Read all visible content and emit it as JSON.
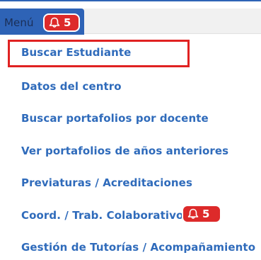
{
  "menu": {
    "label": "Menú",
    "notification_count": "5"
  },
  "items": [
    {
      "label": "Buscar Estudiante"
    },
    {
      "label": "Datos del centro"
    },
    {
      "label": "Buscar portafolios por docente"
    },
    {
      "label": "Ver portafolios de años anteriores"
    },
    {
      "label": "Previaturas / Acreditaciones"
    },
    {
      "label": "Coord. / Trab. Colaborativo",
      "notification_count": "5"
    },
    {
      "label": "Gestión de Tutorías / Acompañamiento"
    }
  ],
  "colors": {
    "accent": "#2e63b6",
    "link": "#2f6bbb",
    "badge": "#dd2a2a",
    "highlight": "#e02222"
  },
  "icons": {
    "badge_icon": "bell-icon"
  }
}
